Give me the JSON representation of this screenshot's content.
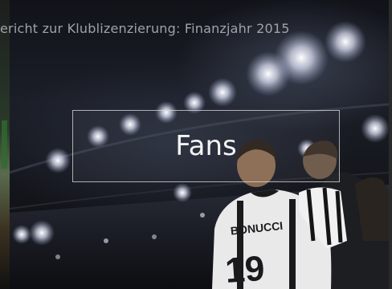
{
  "slide": {
    "subtitle": "ericht zur Klublizenzierung: Finanzjahr 2015",
    "title": "Fans"
  },
  "photo": {
    "jersey_name": "BONUCCI",
    "jersey_number": "19"
  }
}
